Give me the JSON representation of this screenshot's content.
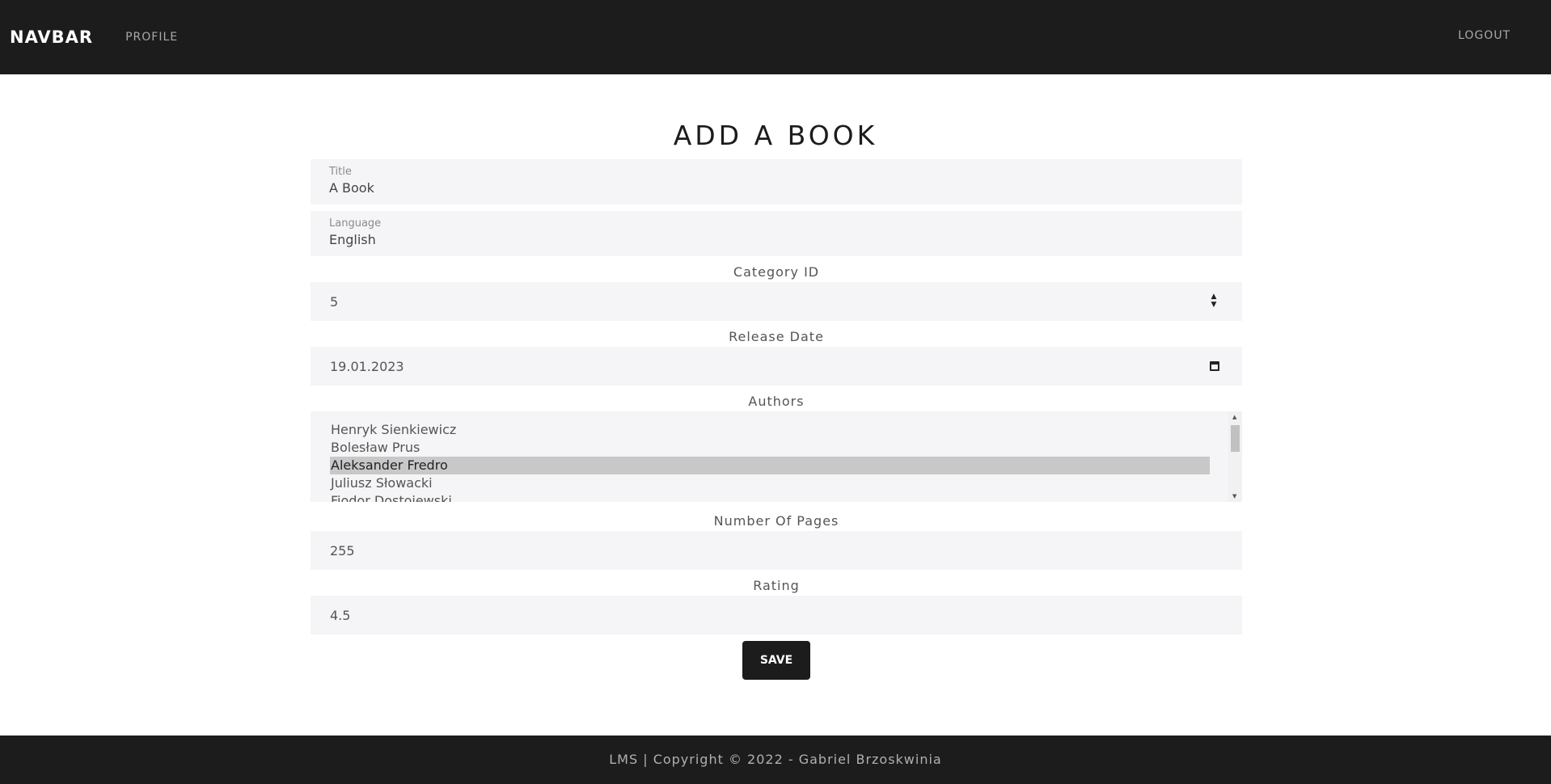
{
  "navbar": {
    "brand": "NAVBAR",
    "profile_label": "PROFILE",
    "logout_label": "LOGOUT"
  },
  "page": {
    "title": "ADD A BOOK"
  },
  "form": {
    "title_field": {
      "label": "Title",
      "value": "A Book"
    },
    "language_field": {
      "label": "Language",
      "value": "English"
    },
    "category": {
      "label": "Category ID",
      "value": "5"
    },
    "release_date": {
      "label": "Release Date",
      "value": "19.01.2023"
    },
    "authors": {
      "label": "Authors",
      "options": [
        "Henryk Sienkiewicz",
        "Bolesław Prus",
        "Aleksander Fredro",
        "Juliusz Słowacki",
        "Fiodor Dostojewski"
      ],
      "selected": "Aleksander Fredro"
    },
    "pages": {
      "label": "Number Of Pages",
      "value": "255"
    },
    "rating": {
      "label": "Rating",
      "value": "4.5"
    },
    "save_label": "SAVE"
  },
  "footer": {
    "text": "LMS | Copyright © 2022 - Gabriel Brzoskwinia"
  },
  "colors": {
    "navbar_bg": "#1c1c1c",
    "field_bg": "#f5f5f7",
    "selected_option_bg": "#c8c8c8"
  },
  "icons": {
    "number_spinner": "spinner-icon",
    "date_picker": "calendar-icon"
  }
}
